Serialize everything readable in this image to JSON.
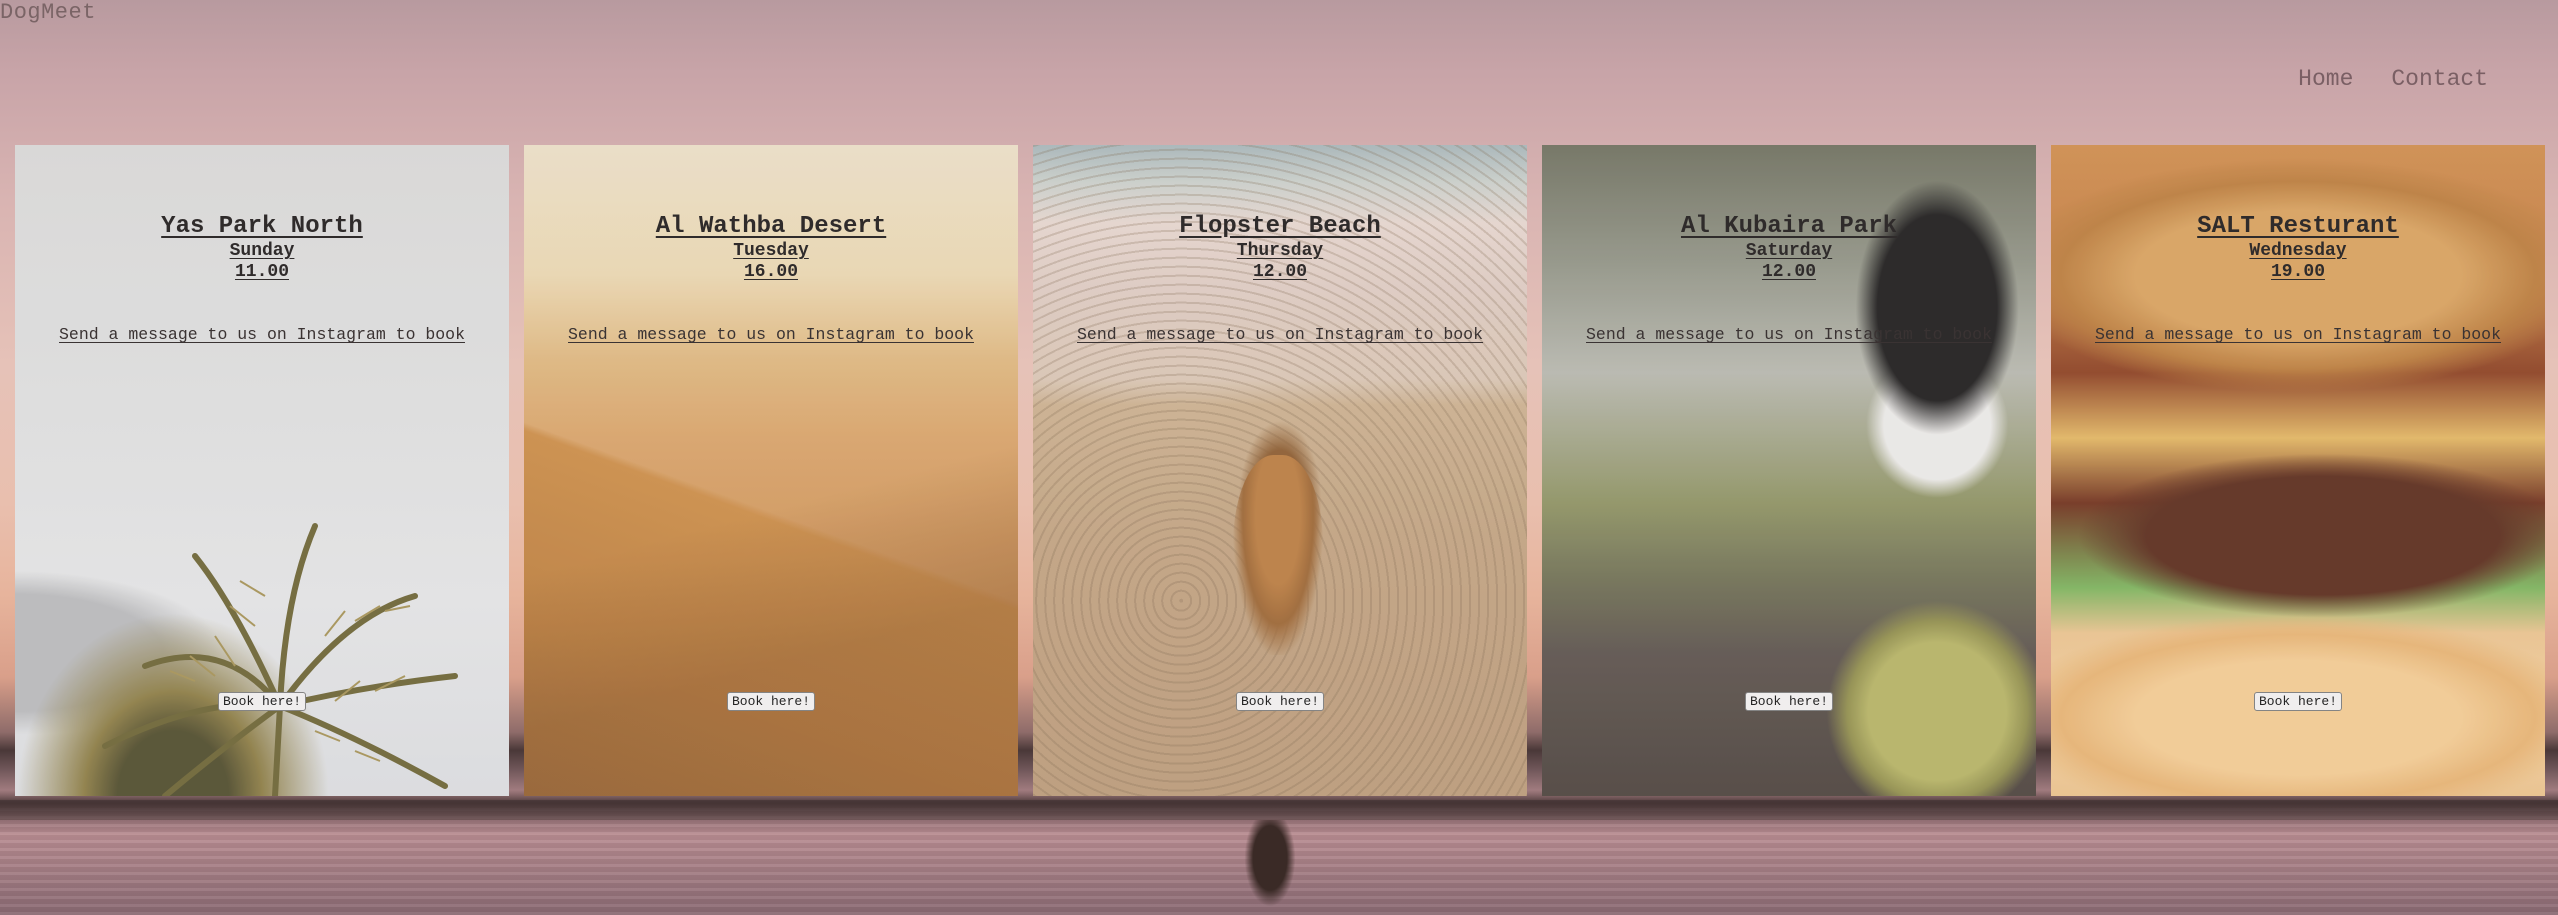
{
  "site": {
    "brand": "DogMeet"
  },
  "nav": {
    "home": "Home",
    "contact": "Contact"
  },
  "cards": [
    {
      "title": "Yas Park North",
      "day": "Sunday",
      "time": "11.00",
      "message": "Send a message to us on Instagram to book",
      "button": "Book here!",
      "image": "palm-tree"
    },
    {
      "title": "Al Wathba Desert",
      "day": "Tuesday",
      "time": "16.00",
      "message": "Send a message to us on Instagram to book",
      "button": "Book here!",
      "image": "desert-dunes"
    },
    {
      "title": "Flopster Beach",
      "day": "Thursday",
      "time": "12.00",
      "message": "Send a message to us on Instagram to book",
      "button": "Book here!",
      "image": "dog-on-beach"
    },
    {
      "title": "Al Kubaira Park",
      "day": "Saturday",
      "time": "12.00",
      "message": "Send a message to us on Instagram to book",
      "button": "Book here!",
      "image": "border-collie-with-ball"
    },
    {
      "title": "SALT Resturant",
      "day": "Wednesday",
      "time": "19.00",
      "message": "Send a message to us on Instagram to book",
      "button": "Book here!",
      "image": "burger"
    }
  ]
}
